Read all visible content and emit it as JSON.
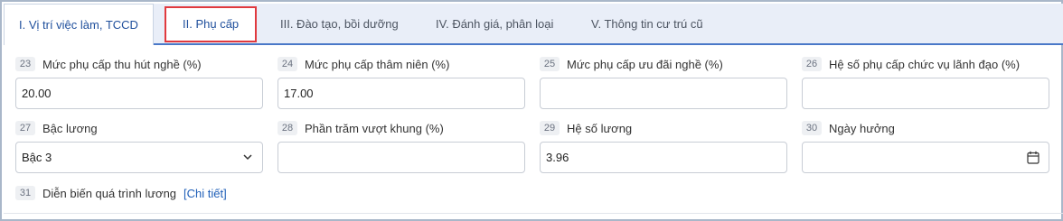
{
  "tabs": [
    {
      "label": "I. Vị trí việc làm, TCCD"
    },
    {
      "label": "II. Phụ cấp"
    },
    {
      "label": "III. Đào tạo, bồi dưỡng"
    },
    {
      "label": "IV. Đánh giá, phân loại"
    },
    {
      "label": "V. Thông tin cư trú cũ"
    }
  ],
  "fields": {
    "f23": {
      "num": "23",
      "label": "Mức phụ cấp thu hút nghề (%)",
      "value": "20.00"
    },
    "f24": {
      "num": "24",
      "label": "Mức phụ cấp thâm niên (%)",
      "value": "17.00"
    },
    "f25": {
      "num": "25",
      "label": "Mức phụ cấp ưu đãi nghề (%)",
      "value": ""
    },
    "f26": {
      "num": "26",
      "label": "Hệ số phụ cấp chức vụ lãnh đạo (%)",
      "value": ""
    },
    "f27": {
      "num": "27",
      "label": "Bậc lương",
      "value": "Bậc 3"
    },
    "f28": {
      "num": "28",
      "label": "Phần trăm vượt khung (%)",
      "value": ""
    },
    "f29": {
      "num": "29",
      "label": "Hệ số lương",
      "value": "3.96"
    },
    "f30": {
      "num": "30",
      "label": "Ngày hưởng",
      "value": ""
    },
    "f31": {
      "num": "31",
      "label": "Diễn biến quá trình lương",
      "link": "[Chi tiết]"
    }
  },
  "icons": {
    "select": "chevron-down-icon",
    "date": "calendar-icon"
  },
  "colors": {
    "accent": "#1f4f9c",
    "tab_bar_bg": "#e9eef8",
    "highlight_border": "#e0393e",
    "link": "#1f5fb8"
  }
}
